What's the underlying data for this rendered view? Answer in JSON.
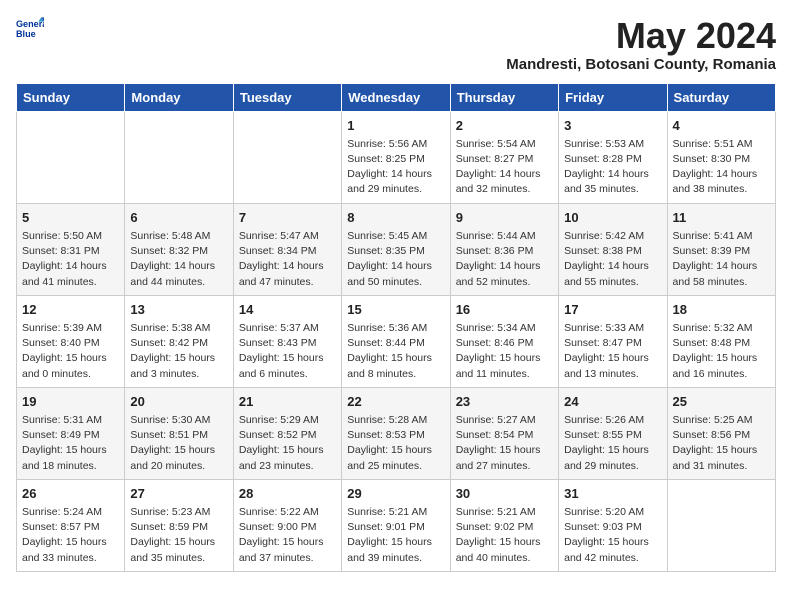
{
  "header": {
    "logo_line1": "General",
    "logo_line2": "Blue",
    "month_year": "May 2024",
    "location": "Mandresti, Botosani County, Romania"
  },
  "days_of_week": [
    "Sunday",
    "Monday",
    "Tuesday",
    "Wednesday",
    "Thursday",
    "Friday",
    "Saturday"
  ],
  "weeks": [
    [
      {
        "day": "",
        "info": ""
      },
      {
        "day": "",
        "info": ""
      },
      {
        "day": "",
        "info": ""
      },
      {
        "day": "1",
        "info": "Sunrise: 5:56 AM\nSunset: 8:25 PM\nDaylight: 14 hours\nand 29 minutes."
      },
      {
        "day": "2",
        "info": "Sunrise: 5:54 AM\nSunset: 8:27 PM\nDaylight: 14 hours\nand 32 minutes."
      },
      {
        "day": "3",
        "info": "Sunrise: 5:53 AM\nSunset: 8:28 PM\nDaylight: 14 hours\nand 35 minutes."
      },
      {
        "day": "4",
        "info": "Sunrise: 5:51 AM\nSunset: 8:30 PM\nDaylight: 14 hours\nand 38 minutes."
      }
    ],
    [
      {
        "day": "5",
        "info": "Sunrise: 5:50 AM\nSunset: 8:31 PM\nDaylight: 14 hours\nand 41 minutes."
      },
      {
        "day": "6",
        "info": "Sunrise: 5:48 AM\nSunset: 8:32 PM\nDaylight: 14 hours\nand 44 minutes."
      },
      {
        "day": "7",
        "info": "Sunrise: 5:47 AM\nSunset: 8:34 PM\nDaylight: 14 hours\nand 47 minutes."
      },
      {
        "day": "8",
        "info": "Sunrise: 5:45 AM\nSunset: 8:35 PM\nDaylight: 14 hours\nand 50 minutes."
      },
      {
        "day": "9",
        "info": "Sunrise: 5:44 AM\nSunset: 8:36 PM\nDaylight: 14 hours\nand 52 minutes."
      },
      {
        "day": "10",
        "info": "Sunrise: 5:42 AM\nSunset: 8:38 PM\nDaylight: 14 hours\nand 55 minutes."
      },
      {
        "day": "11",
        "info": "Sunrise: 5:41 AM\nSunset: 8:39 PM\nDaylight: 14 hours\nand 58 minutes."
      }
    ],
    [
      {
        "day": "12",
        "info": "Sunrise: 5:39 AM\nSunset: 8:40 PM\nDaylight: 15 hours\nand 0 minutes."
      },
      {
        "day": "13",
        "info": "Sunrise: 5:38 AM\nSunset: 8:42 PM\nDaylight: 15 hours\nand 3 minutes."
      },
      {
        "day": "14",
        "info": "Sunrise: 5:37 AM\nSunset: 8:43 PM\nDaylight: 15 hours\nand 6 minutes."
      },
      {
        "day": "15",
        "info": "Sunrise: 5:36 AM\nSunset: 8:44 PM\nDaylight: 15 hours\nand 8 minutes."
      },
      {
        "day": "16",
        "info": "Sunrise: 5:34 AM\nSunset: 8:46 PM\nDaylight: 15 hours\nand 11 minutes."
      },
      {
        "day": "17",
        "info": "Sunrise: 5:33 AM\nSunset: 8:47 PM\nDaylight: 15 hours\nand 13 minutes."
      },
      {
        "day": "18",
        "info": "Sunrise: 5:32 AM\nSunset: 8:48 PM\nDaylight: 15 hours\nand 16 minutes."
      }
    ],
    [
      {
        "day": "19",
        "info": "Sunrise: 5:31 AM\nSunset: 8:49 PM\nDaylight: 15 hours\nand 18 minutes."
      },
      {
        "day": "20",
        "info": "Sunrise: 5:30 AM\nSunset: 8:51 PM\nDaylight: 15 hours\nand 20 minutes."
      },
      {
        "day": "21",
        "info": "Sunrise: 5:29 AM\nSunset: 8:52 PM\nDaylight: 15 hours\nand 23 minutes."
      },
      {
        "day": "22",
        "info": "Sunrise: 5:28 AM\nSunset: 8:53 PM\nDaylight: 15 hours\nand 25 minutes."
      },
      {
        "day": "23",
        "info": "Sunrise: 5:27 AM\nSunset: 8:54 PM\nDaylight: 15 hours\nand 27 minutes."
      },
      {
        "day": "24",
        "info": "Sunrise: 5:26 AM\nSunset: 8:55 PM\nDaylight: 15 hours\nand 29 minutes."
      },
      {
        "day": "25",
        "info": "Sunrise: 5:25 AM\nSunset: 8:56 PM\nDaylight: 15 hours\nand 31 minutes."
      }
    ],
    [
      {
        "day": "26",
        "info": "Sunrise: 5:24 AM\nSunset: 8:57 PM\nDaylight: 15 hours\nand 33 minutes."
      },
      {
        "day": "27",
        "info": "Sunrise: 5:23 AM\nSunset: 8:59 PM\nDaylight: 15 hours\nand 35 minutes."
      },
      {
        "day": "28",
        "info": "Sunrise: 5:22 AM\nSunset: 9:00 PM\nDaylight: 15 hours\nand 37 minutes."
      },
      {
        "day": "29",
        "info": "Sunrise: 5:21 AM\nSunset: 9:01 PM\nDaylight: 15 hours\nand 39 minutes."
      },
      {
        "day": "30",
        "info": "Sunrise: 5:21 AM\nSunset: 9:02 PM\nDaylight: 15 hours\nand 40 minutes."
      },
      {
        "day": "31",
        "info": "Sunrise: 5:20 AM\nSunset: 9:03 PM\nDaylight: 15 hours\nand 42 minutes."
      },
      {
        "day": "",
        "info": ""
      }
    ]
  ]
}
